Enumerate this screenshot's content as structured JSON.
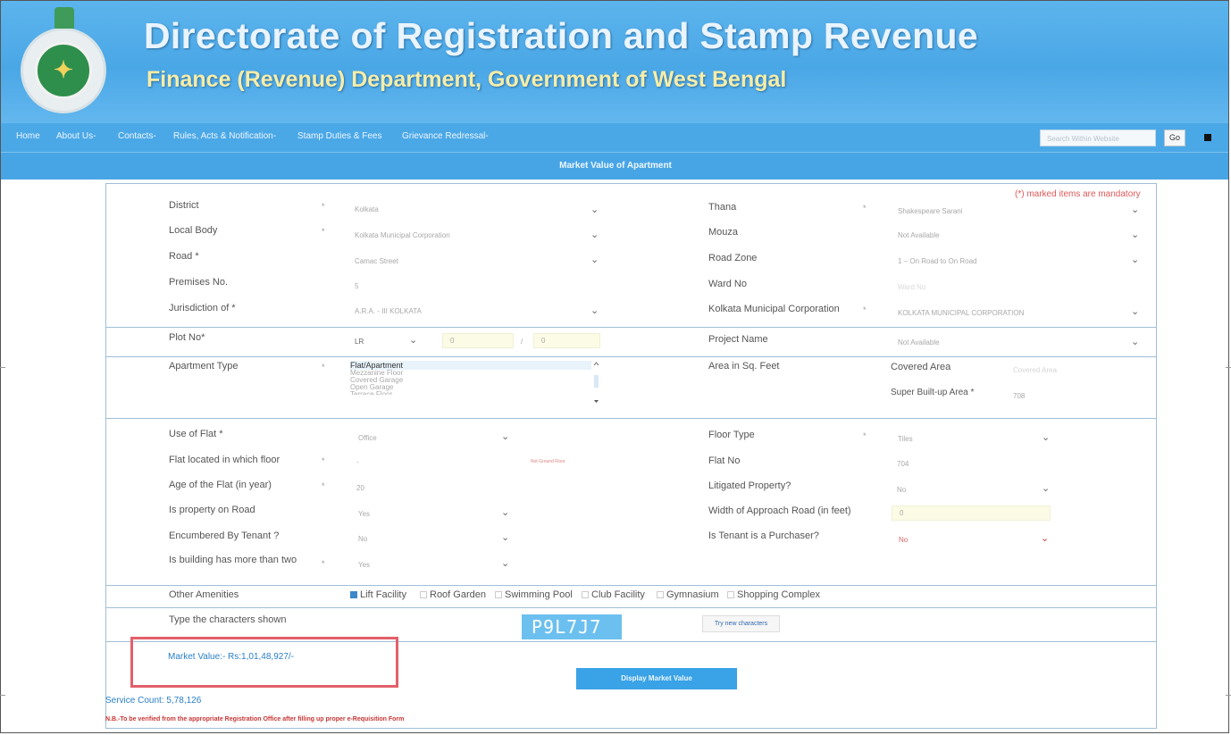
{
  "header": {
    "title": "Directorate of Registration and Stamp Revenue",
    "subtitle": "Finance (Revenue) Department, Government of West Bengal"
  },
  "nav": {
    "items": [
      "Home",
      "About Us-",
      "Contacts-",
      "Rules, Acts & Notification-",
      "Stamp Duties & Fees",
      "Grievance Redressal-"
    ],
    "search_placeholder": "Search Within Website",
    "go_label": "Go"
  },
  "page_title": "Market Value of Apartment",
  "mandatory_note": "(*) marked items are mandatory",
  "fields": {
    "district": {
      "label": "District",
      "star": "*",
      "value": "Kolkata"
    },
    "thana": {
      "label": "Thana",
      "star": "*",
      "value": "Shakespeare Sarani"
    },
    "local_body": {
      "label": "Local Body",
      "star": "*",
      "value": "Kolkata Municipal Corporation"
    },
    "mouza": {
      "label": "Mouza",
      "value": "Not Available"
    },
    "road": {
      "label": "Road *",
      "value": "Camac Street"
    },
    "road_zone": {
      "label": "Road Zone",
      "value": "1 – On Road to On Road"
    },
    "premises_no": {
      "label": "Premises No.",
      "value": "5"
    },
    "ward_no": {
      "label": "Ward No",
      "value": "Ward No"
    },
    "jurisdiction": {
      "label": "Jurisdiction of *",
      "value": "A.R.A. - III KOLKATA"
    },
    "kmc": {
      "label": "Kolkata Municipal Corporation",
      "star": "*",
      "value": "KOLKATA MUNICIPAL CORPORATION"
    },
    "plot_no": {
      "label": "Plot No*",
      "type": "LR",
      "value1": "0",
      "sep": "/",
      "value2": "0"
    },
    "project_name": {
      "label": "Project Name",
      "value": "Not Available"
    },
    "apartment_type": {
      "label": "Apartment Type",
      "star": "*",
      "options": [
        "Flat/Apartment",
        "Mezzanine Floor",
        "Covered Garage",
        "Open Garage",
        "Terrace Floor"
      ]
    },
    "area": {
      "label": "Area in Sq. Feet",
      "covered_label": "Covered Area",
      "covered_placeholder": "Covered Area",
      "super_label": "Super Built-up Area *",
      "super_value": "708"
    },
    "use_of_flat": {
      "label": "Use of Flat *",
      "value": "Office"
    },
    "floor_type": {
      "label": "Floor Type",
      "star": "*",
      "value": "Tiles"
    },
    "flat_floor": {
      "label": "Flat located in which floor",
      "star": "*",
      "value": "-",
      "note": "Not Ground Floor"
    },
    "flat_no": {
      "label": "Flat No",
      "value": "704"
    },
    "age": {
      "label": "Age of the Flat (in year)",
      "star": "*",
      "value": "20"
    },
    "litigated": {
      "label": "Litigated Property?",
      "value": "No"
    },
    "on_road": {
      "label": "Is property on Road",
      "value": "Yes"
    },
    "approach_road": {
      "label": "Width of Approach Road (in feet)",
      "value": "0"
    },
    "encumbered": {
      "label": "Encumbered By Tenant ?",
      "value": "No"
    },
    "tenant_purchaser": {
      "label": "Is Tenant is a Purchaser?",
      "value": "No"
    },
    "two_floors": {
      "label": "Is building has more than two floors ?",
      "star": "*",
      "value": "Yes"
    }
  },
  "amenities": {
    "label": "Other Amenities",
    "items": [
      {
        "name": "Lift Facility",
        "checked": true
      },
      {
        "name": "Roof Garden",
        "checked": false
      },
      {
        "name": "Swimming Pool",
        "checked": false
      },
      {
        "name": "Club Facility",
        "checked": false
      },
      {
        "name": "Gymnasium",
        "checked": false
      },
      {
        "name": "Shopping Complex",
        "checked": false
      }
    ]
  },
  "captcha": {
    "label": "Type the characters shown",
    "text": "P9L7J7",
    "try_new": "Try new characters"
  },
  "result": {
    "market_value": "Market Value:- Rs:1,01,48,927/-",
    "display_button": "Display Market Value",
    "service_count": "Service Count: 5,78,126",
    "note": "N.B.-To be verified from the appropriate Registration Office after filling up proper e-Requisition Form"
  },
  "colors": {
    "header_bg": "#4aa7e6",
    "accent_red": "#e2606a",
    "link_blue": "#2a7fc8",
    "captcha_bg": "#6cc0ef"
  }
}
